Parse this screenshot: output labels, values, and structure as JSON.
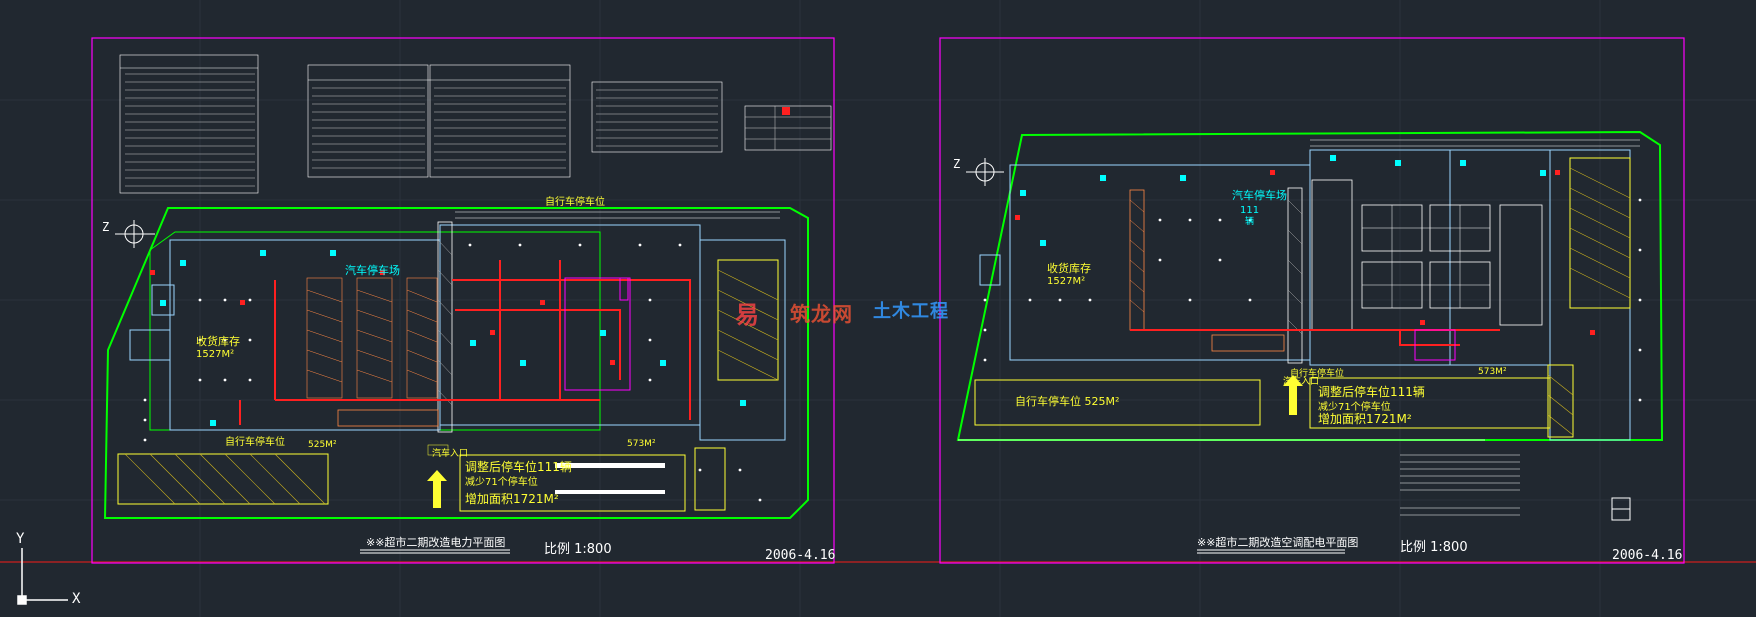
{
  "colors": {
    "background": "#212830",
    "sheet_border": "#ff00ff",
    "building_outline": "#00ff00",
    "annotation": "#ffff33",
    "cyan_text": "#00ffff",
    "red_line": "#ff2020",
    "white": "#ffffff"
  },
  "sheets": [
    {
      "title": "※※超市二期改造电力平面图",
      "scale": "比例 1:800",
      "date": "2006-4.16",
      "labels": {
        "car_park": "汽车停车场",
        "bike_park_top": "自行车停车位",
        "bike_park_bottom": "自行车停车位",
        "car_entry": "汽车入口",
        "storage_area": "收货库存",
        "storage_area_sqm": "1527M²",
        "bike_area_sqm": "525M²",
        "area_sqm_2": "573M²",
        "adjusted_spaces": "调整后停车位111辆",
        "reduced_spaces": "减少71个停车位",
        "added_area": "增加面积1721M²"
      }
    },
    {
      "title": "※※超市二期改造空调配电平面图",
      "scale": "比例 1:800",
      "date": "2006-4.16",
      "labels": {
        "car_park": "汽车停车场",
        "car_count": "111",
        "car_unit": "辆",
        "bike_park": "自行车停车位",
        "storage_area": "收货库存",
        "storage_area_sqm": "1527M²",
        "bike_area": "自行车停车位  525M²",
        "car_entry": "汽车入口",
        "area_sqm_2": "573M²",
        "adjusted_spaces": "调整后停车位111辆",
        "reduced_spaces": "减少71个停车位",
        "added_area": "增加面积1721M²"
      }
    }
  ],
  "watermark": {
    "text_a": "易",
    "text_b": "筑龙网",
    "text_c": "土木工程"
  },
  "ucs": {
    "y_axis": "Y",
    "x_axis": "X",
    "north_mark": "Z"
  }
}
